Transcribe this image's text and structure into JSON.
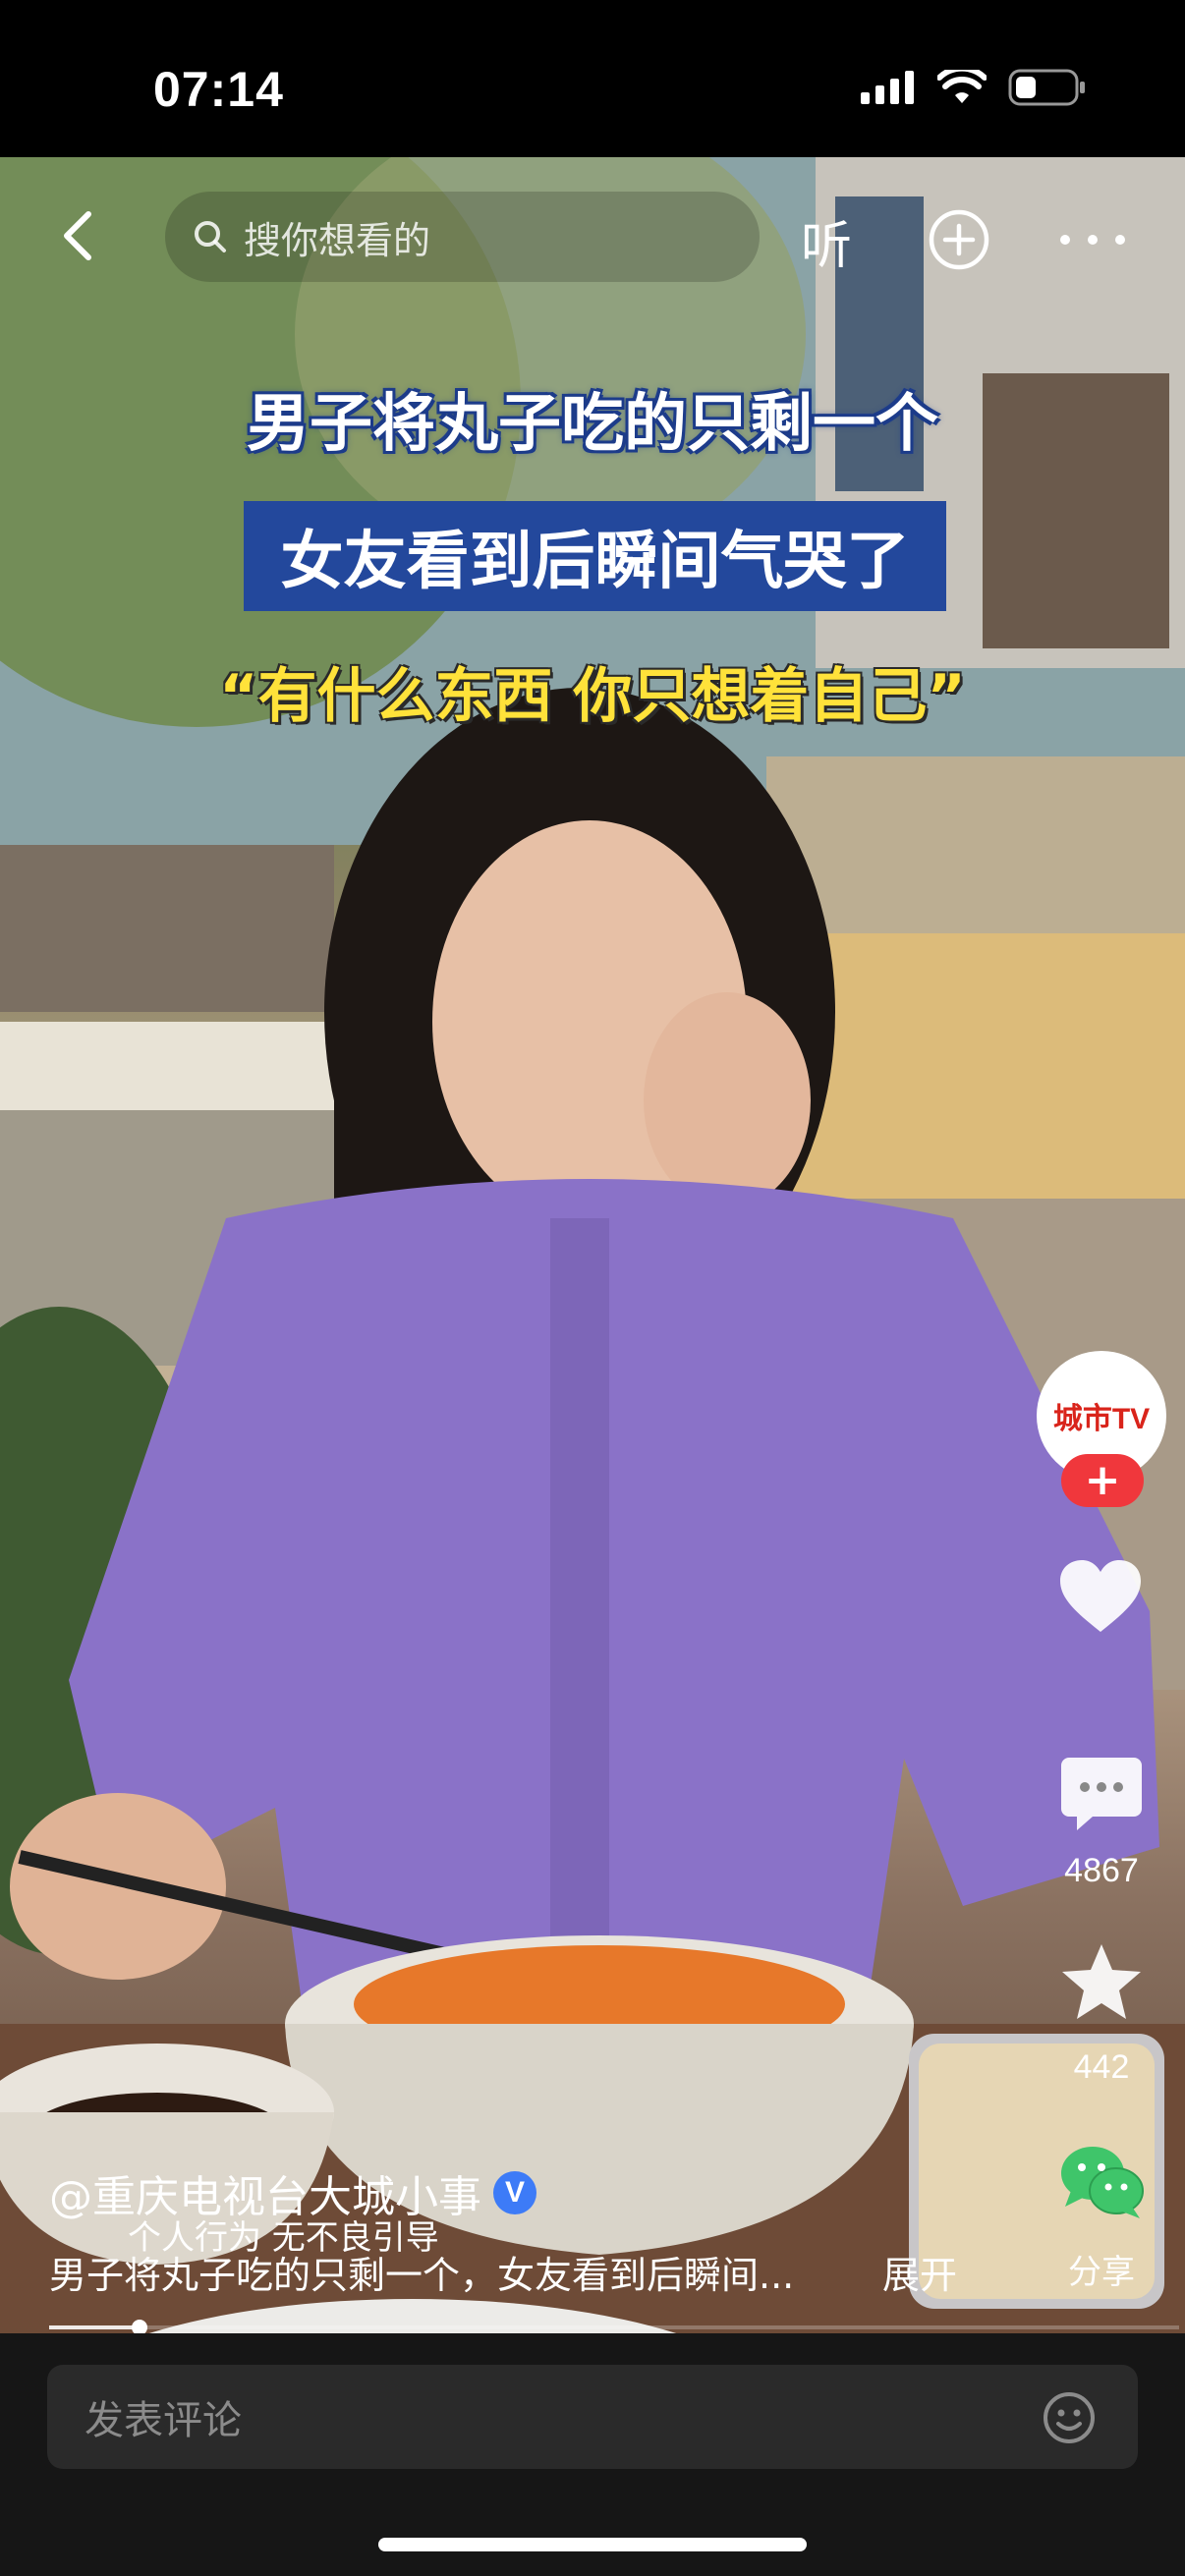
{
  "status_bar": {
    "time": "07:14"
  },
  "top_bar": {
    "search_placeholder": "搜你想看的",
    "listen_label": "听"
  },
  "captions": {
    "line1": "男子将丸子吃的只剩一个",
    "line2": "女友看到后瞬间气哭了",
    "line3": "“有什么东西 你只想着自己”"
  },
  "side_actions": {
    "avatar_text": "城市TV",
    "follow_label": "+",
    "comment_count": "4867",
    "favorite_count": "442",
    "share_label": "分享"
  },
  "video_info": {
    "author": "@重庆电视台大城小事",
    "verified_mark": "V",
    "disclaimer": "个人行为 无不良引导",
    "description": "男子将丸子吃的只剩一个，女友看到后瞬间...",
    "expand_label": "展开",
    "progress_fraction": 0.08
  },
  "comment_bar": {
    "placeholder": "发表评论"
  },
  "colors": {
    "caption_blue": "#23489c",
    "caption_yellow": "#ffe23a",
    "follow_red": "#f0373c",
    "verified_blue": "#3d7bf7"
  }
}
